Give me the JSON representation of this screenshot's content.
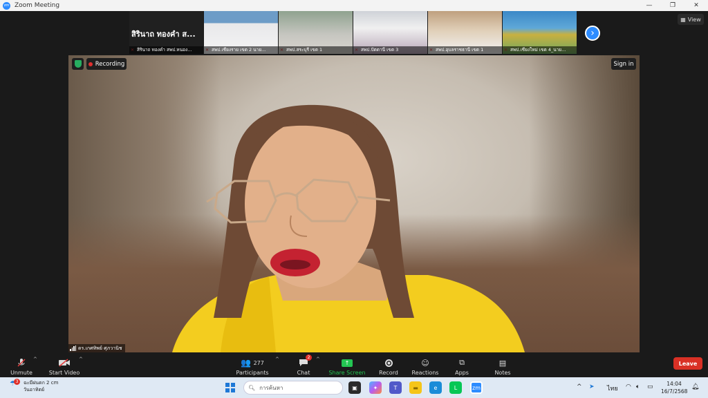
{
  "window": {
    "title": "Zoom Meeting"
  },
  "strip": {
    "tiles": [
      {
        "name": "สิรินาถ ทองคำ สพป.หนอง...",
        "big": "สิรินาถ  ทองคำ ส..."
      },
      {
        "name": "สพป.เชียงราย เขต 2 นาย..."
      },
      {
        "name": "สพป.สระบุรี เขต 1"
      },
      {
        "name": "สพป.ปัตตานี เขต 3"
      },
      {
        "name": "สพป.อุบลราชธานี เขต 1"
      },
      {
        "name": "สพป.เชียงใหม่ เขต 4_นาย..."
      }
    ],
    "next_icon": "chevron-right-icon"
  },
  "view_label": "View",
  "recording_label": "Recording",
  "signin_label": "Sign in",
  "speaker": {
    "name": "ดร.เกศทิพย์ ศุภวานิช"
  },
  "toolbar": {
    "unmute": "Unmute",
    "start_video": "Start Video",
    "participants": "Participants",
    "participants_count": "277",
    "chat": "Chat",
    "chat_badge": "2",
    "share_screen": "Share Screen",
    "record": "Record",
    "reactions": "Reactions",
    "apps": "Apps",
    "notes": "Notes",
    "leave": "Leave"
  },
  "taskbar": {
    "weather_badge": "3",
    "weather_line1": "ฉะมีฝนตก 2 cm",
    "weather_line2": "วันอาทิตย์",
    "search_placeholder": "การค้นหา",
    "lang": "ไทย",
    "time": "14:04",
    "date": "16/7/2568"
  },
  "colors": {
    "accent": "#2d8cff",
    "leave": "#d93025",
    "share": "#23c552"
  }
}
